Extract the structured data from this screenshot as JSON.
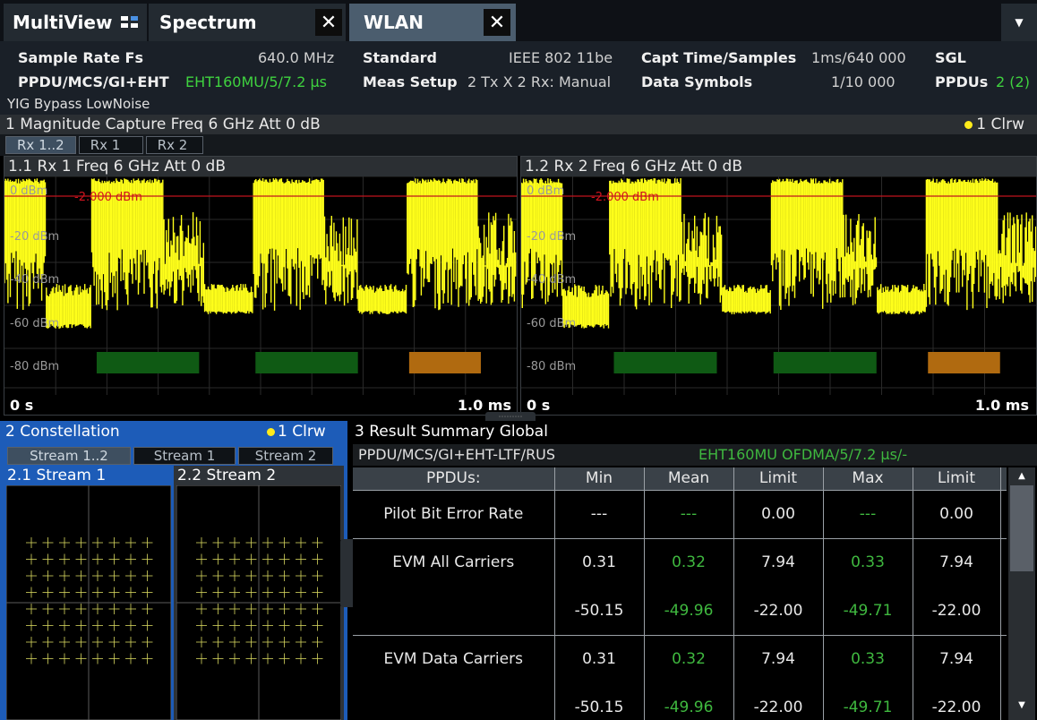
{
  "tabs": {
    "multiview": "MultiView",
    "spectrum": "Spectrum",
    "wlan": "WLAN",
    "close_glyph": "✕",
    "dropdown_glyph": "▼"
  },
  "settings": {
    "sample_rate_label": "Sample Rate Fs",
    "sample_rate_value": "640.0 MHz",
    "standard_label": "Standard",
    "standard_value": "IEEE 802 11be",
    "capt_label": "Capt Time/Samples",
    "capt_value": "1ms/640 000",
    "sgl": "SGL",
    "ppdu_label": "PPDU/MCS/GI+EHT",
    "ppdu_value": "EHT160MU/5/7.2 µs",
    "meas_label": "Meas Setup",
    "meas_value": "2 Tx X 2 Rx: Manual",
    "data_symbols_label": "Data Symbols",
    "data_symbols_value": "1/10 000",
    "ppdus_label": "PPDUs",
    "ppdus_value": "2 (2)",
    "yig": "YIG Bypass LowNoise"
  },
  "magnitude": {
    "title": "1 Magnitude Capture  Freq 6 GHz Att 0 dB",
    "trace": "1 Clrw",
    "subtabs": [
      "Rx 1..2",
      "Rx 1",
      "Rx 2"
    ],
    "plots": [
      {
        "title": "1.1 Rx 1  Freq 6 GHz Att 0 dB",
        "x_start": "0 s",
        "x_end": "1.0 ms"
      },
      {
        "title": "1.2 Rx 2  Freq 6 GHz Att 0 dB",
        "x_start": "0 s",
        "x_end": "1.0 ms"
      }
    ],
    "ylabels": [
      "0 dBm",
      "-20 dBm",
      "-40 dBm",
      "-60 dBm",
      "-80 dBm"
    ],
    "marker_label": "-2.000 dBm",
    "colors": {
      "trace": "#ffff1a",
      "ref_line": "#c0141e",
      "burst_green": "#0f5a14",
      "burst_orange": "#b06a10"
    }
  },
  "constellation": {
    "title": "2 Constellation",
    "trace": "1 Clrw",
    "subtabs": [
      "Stream 1..2",
      "Stream 1",
      "Stream 2"
    ],
    "plots": [
      "2.1 Stream 1",
      "2.2 Stream 2"
    ],
    "accent": "#1d5cb8"
  },
  "result_summary": {
    "title": "3 Result Summary Global",
    "ppdu_label": "PPDU/MCS/GI+EHT-LTF/RUS",
    "ppdu_value": "EHT160MU OFDMA/5/7.2 µs/-",
    "headers": [
      "PPDUs:",
      "Min",
      "Mean",
      "Limit",
      "Max",
      "Limit"
    ],
    "rows": [
      {
        "name": "Pilot Bit Error Rate",
        "cells": [
          "---",
          "---",
          "0.00",
          "---",
          "0.00"
        ]
      },
      {
        "name": "EVM All Carriers",
        "cells": [
          "0.31",
          "0.32",
          "7.94",
          "0.33",
          "7.94"
        ],
        "cells2": [
          "-50.15",
          "-49.96",
          "-22.00",
          "-49.71",
          "-22.00"
        ]
      },
      {
        "name": "EVM Data Carriers",
        "cells": [
          "0.31",
          "0.32",
          "7.94",
          "0.33",
          "7.94"
        ],
        "cells2": [
          "-50.15",
          "-49.96",
          "-22.00",
          "-49.71",
          "-22.00"
        ]
      }
    ]
  }
}
